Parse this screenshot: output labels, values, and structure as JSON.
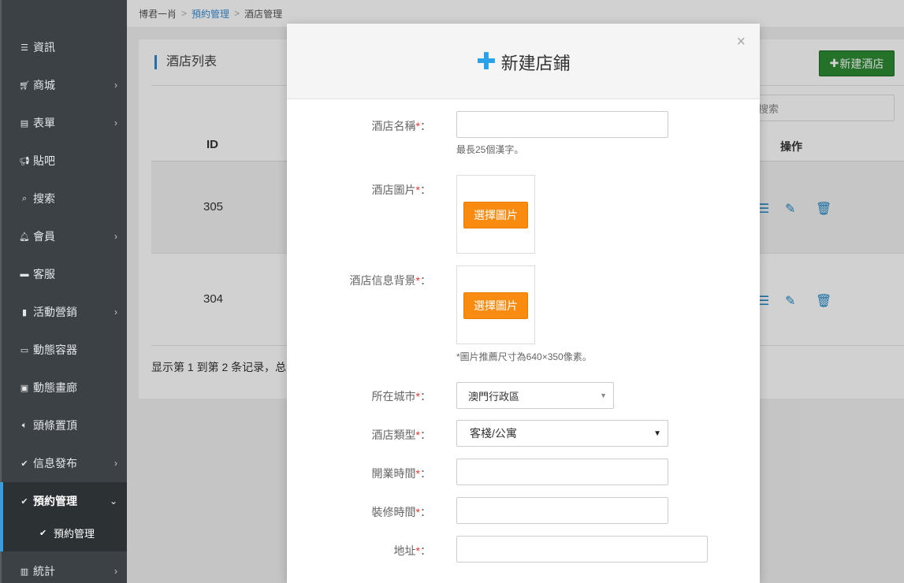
{
  "breadcrumb": {
    "home": "博君一肖",
    "section": "預約管理",
    "current": "酒店管理"
  },
  "sidebar": {
    "items": [
      {
        "label": "資訊",
        "icon": "list-icon",
        "chevron": false
      },
      {
        "label": "商城",
        "icon": "cart-icon",
        "chevron": true
      },
      {
        "label": "表單",
        "icon": "form-icon",
        "chevron": true
      },
      {
        "label": "貼吧",
        "icon": "megaphone-icon",
        "chevron": false
      },
      {
        "label": "搜索",
        "icon": "search-icon",
        "chevron": false
      },
      {
        "label": "會員",
        "icon": "bell-icon",
        "chevron": true
      },
      {
        "label": "客服",
        "icon": "comment-icon",
        "chevron": false
      },
      {
        "label": "活動營銷",
        "icon": "bookmark-icon",
        "chevron": true
      },
      {
        "label": "動態容器",
        "icon": "inbox-icon",
        "chevron": false
      },
      {
        "label": "動態畫廊",
        "icon": "picture-icon",
        "chevron": false
      },
      {
        "label": "頭條置頂",
        "icon": "volume-icon",
        "chevron": false
      },
      {
        "label": "信息發布",
        "icon": "check-icon",
        "chevron": true
      },
      {
        "label": "預約管理",
        "icon": "check-icon",
        "chevron": true
      },
      {
        "label": "統計",
        "icon": "bar-chart-icon",
        "chevron": true
      }
    ],
    "sub_item": "預約管理"
  },
  "page": {
    "title": "酒店列表",
    "new_button": "新建酒店",
    "search_placeholder": "搜索",
    "columns": {
      "id": "ID",
      "actions": "操作"
    },
    "rows": [
      {
        "id": "305"
      },
      {
        "id": "304"
      }
    ],
    "footer": "显示第 1 到第 2 条记录，总"
  },
  "modal": {
    "title": "新建店鋪",
    "close": "×",
    "fields": {
      "name_label": "酒店名稱",
      "name_hint": "最長25個漢字。",
      "image_label": "酒店圖片",
      "bg_label": "酒店信息背景",
      "upload_button": "選擇圖片",
      "image_hint": "*圖片推薦尺寸為640×350像素。",
      "city_label": "所在城市",
      "city_value": "澳門行政區",
      "type_label": "酒店類型",
      "type_value": "客棧/公寓",
      "open_label": "開業時間",
      "renovate_label": "裝修時間",
      "address_label": "地址",
      "required_mark": "*",
      "colon": "："
    }
  },
  "colors": {
    "accent": "#2aa2e8",
    "upload": "#f98c10",
    "new_button": "#2c8a32",
    "required": "#e33333"
  }
}
